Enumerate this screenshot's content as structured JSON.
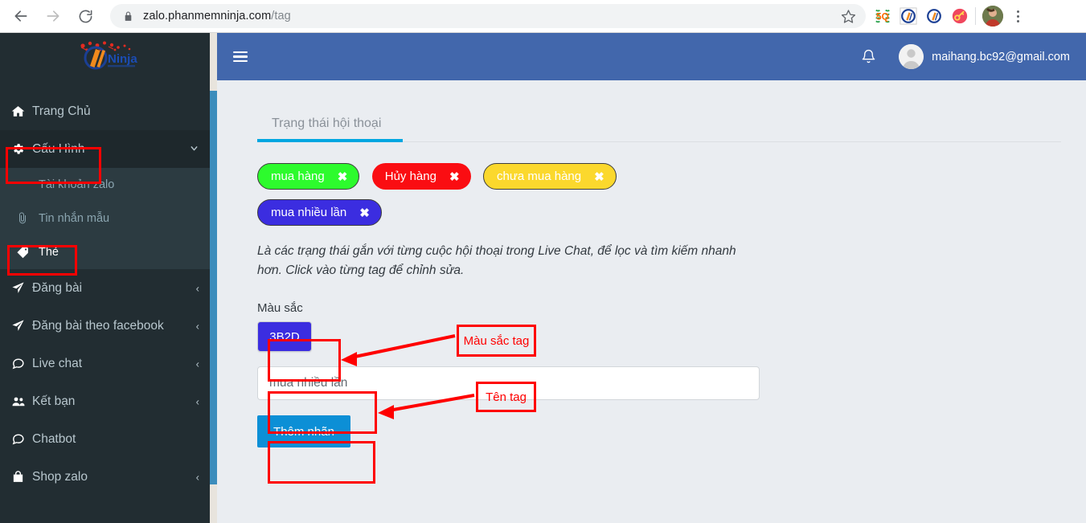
{
  "browser": {
    "url_main": "zalo.phanmemninja.com",
    "url_path": "/tag",
    "back_icon": "back-arrow-icon",
    "forward_icon": "forward-arrow-icon",
    "reload_icon": "reload-icon",
    "lock_icon": "lock-icon",
    "star_icon": "bookmark-star-icon",
    "extensions": [
      "sq-extension-icon",
      "ninja-extension-icon",
      "ninja-extension-icon-2",
      "key-extension-icon"
    ],
    "profile_icon": "profile-avatar",
    "menu_icon": "three-dot-menu-icon"
  },
  "sidebar": {
    "logo_text": "Ninja",
    "items": [
      {
        "label": "Trang Chủ",
        "icon": "home-icon",
        "caret": "",
        "active": false
      },
      {
        "label": "Cấu Hình",
        "icon": "gear-icon",
        "caret": "⌄",
        "active": true
      },
      {
        "label": "Đăng bài",
        "icon": "paper-plane-icon",
        "caret": "‹",
        "active": false
      },
      {
        "label": "Đăng bài theo facebook",
        "icon": "paper-plane-icon",
        "caret": "‹",
        "active": false
      },
      {
        "label": "Live chat",
        "icon": "chat-bubble-icon",
        "caret": "‹",
        "active": false
      },
      {
        "label": "Kết bạn",
        "icon": "users-icon",
        "caret": "‹",
        "active": false
      },
      {
        "label": "Chatbot",
        "icon": "chat-bubble-icon",
        "caret": "",
        "active": false
      },
      {
        "label": "Shop zalo",
        "icon": "shop-bag-icon",
        "caret": "‹",
        "active": false
      }
    ],
    "submenu": [
      {
        "label": "Tài khoản zalo",
        "icon": "",
        "highlight": false
      },
      {
        "label": "Tin nhắn mẫu",
        "icon": "paperclip-icon",
        "highlight": false
      },
      {
        "label": "Thẻ",
        "icon": "tag-icon",
        "highlight": true
      }
    ]
  },
  "topbar": {
    "menu_toggle_icon": "hamburger-icon",
    "bell_icon": "bell-icon",
    "user_email": "maihang.bc92@gmail.com",
    "background": "#4267ac"
  },
  "main": {
    "tab_label": "Trạng thái hội thoại",
    "tags": [
      {
        "label": "mua hàng",
        "color": "#2dfb2d",
        "text_color": "#ffffff",
        "bordered": true,
        "close_icon": "close-x-icon"
      },
      {
        "label": "Hủy hàng",
        "color": "#fa0d12",
        "text_color": "#ffffff",
        "bordered": false,
        "close_icon": "close-x-icon"
      },
      {
        "label": "chưa mua hàng",
        "color": "#fbd82d",
        "text_color": "#ffffff",
        "bordered": true,
        "close_icon": "close-x-icon"
      },
      {
        "label": "mua nhiều lần",
        "color": "#3b2de0",
        "text_color": "#ffffff",
        "bordered": true,
        "close_icon": "close-x-icon"
      }
    ],
    "description": "Là các trạng thái gắn với từng cuộc hội thoại trong Live Chat, để lọc và tìm kiếm nhanh hơn. Click vào từng tag để chỉnh sửa.",
    "color_field_label": "Màu sắc",
    "color_value": "3B2D",
    "color_hex": "#3b2de0",
    "tag_name_value": "mua nhiều lần",
    "add_button_label": "Thêm nhãn"
  },
  "annotations": {
    "color_callout": "Màu sắc tag",
    "name_callout": "Tên tag",
    "color": "#ff0000"
  }
}
